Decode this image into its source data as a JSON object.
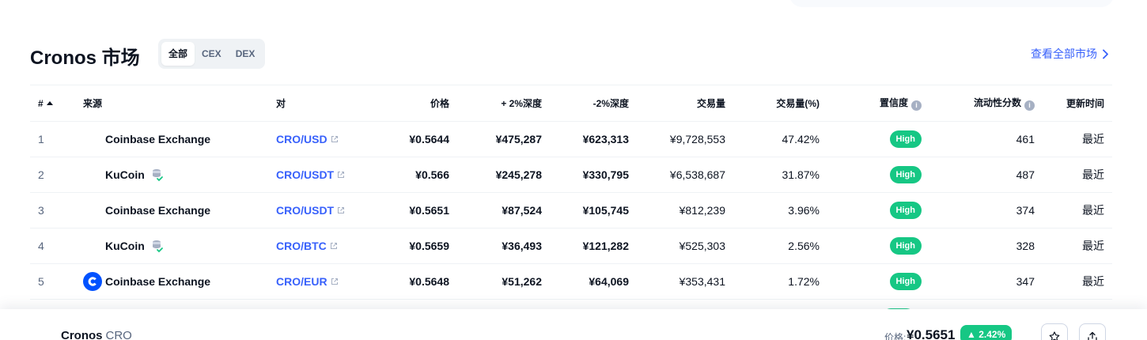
{
  "header": {
    "title": "Cronos 市场",
    "filters": [
      "全部",
      "CEX",
      "DEX"
    ],
    "active_filter": "全部",
    "view_all": "查看全部市场"
  },
  "table": {
    "headers": {
      "rank": "#",
      "source": "来源",
      "pair": "对",
      "price": "价格",
      "depth_plus": "+ 2%深度",
      "depth_minus": "-2%深度",
      "volume": "交易量",
      "volume_pct": "交易量(%)",
      "confidence": "置信度",
      "liquidity": "流动性分数",
      "updated": "更新时间"
    },
    "rows": [
      {
        "rank": "1",
        "source": "Coinbase Exchange",
        "pair": "CRO/USD",
        "price": "¥0.5644",
        "depth_plus": "¥475,287",
        "depth_minus": "¥623,313",
        "volume": "¥9,728,553",
        "volume_pct": "47.42%",
        "confidence": "High",
        "liquidity": "461",
        "updated": "最近"
      },
      {
        "rank": "2",
        "source": "KuCoin",
        "pair": "CRO/USDT",
        "price": "¥0.566",
        "depth_plus": "¥245,278",
        "depth_minus": "¥330,795",
        "volume": "¥6,538,687",
        "volume_pct": "31.87%",
        "confidence": "High",
        "liquidity": "487",
        "updated": "最近"
      },
      {
        "rank": "3",
        "source": "Coinbase Exchange",
        "pair": "CRO/USDT",
        "price": "¥0.5651",
        "depth_plus": "¥87,524",
        "depth_minus": "¥105,745",
        "volume": "¥812,239",
        "volume_pct": "3.96%",
        "confidence": "High",
        "liquidity": "374",
        "updated": "最近"
      },
      {
        "rank": "4",
        "source": "KuCoin",
        "pair": "CRO/BTC",
        "price": "¥0.5659",
        "depth_plus": "¥36,493",
        "depth_minus": "¥121,282",
        "volume": "¥525,303",
        "volume_pct": "2.56%",
        "confidence": "High",
        "liquidity": "328",
        "updated": "最近"
      },
      {
        "rank": "5",
        "source": "Coinbase Exchange",
        "pair": "CRO/EUR",
        "price": "¥0.5648",
        "depth_plus": "¥51,262",
        "depth_minus": "¥64,069",
        "volume": "¥353,431",
        "volume_pct": "1.72%",
        "confidence": "High",
        "liquidity": "347",
        "updated": "最近"
      }
    ]
  },
  "footer": {
    "name": "Cronos",
    "symbol": "CRO",
    "price_label": "价格:",
    "price": "¥0.5651",
    "change": "2.42%"
  },
  "colors": {
    "accent": "#3861fb",
    "positive": "#16c784",
    "text": "#0d1421",
    "muted": "#58667e"
  }
}
